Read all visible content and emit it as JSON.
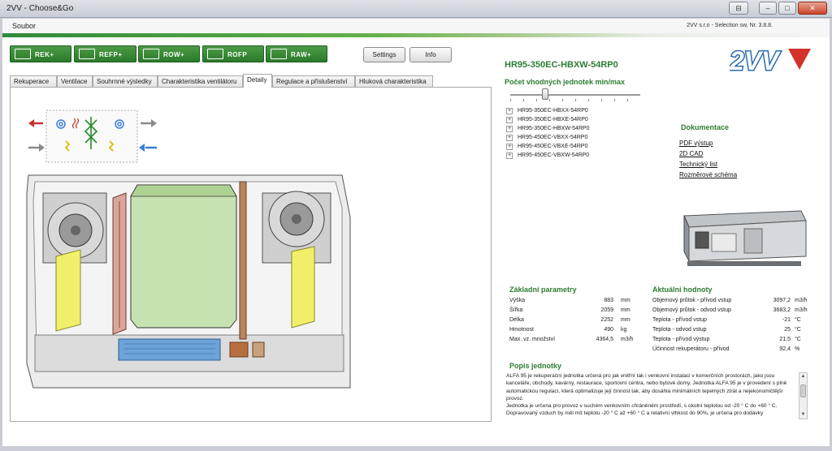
{
  "window": {
    "title": "2VV - Choose&Go",
    "menu_file": "Soubor",
    "version": "2VV s.r.o - Selection sw, Nr. 3.8.8."
  },
  "toolbar": {
    "buttons": [
      {
        "label": "REK+",
        "icon": "recuperator-icon"
      },
      {
        "label": "REFP+",
        "icon": "heat-exchanger-icon"
      },
      {
        "label": "ROW+",
        "icon": "row-unit-icon"
      },
      {
        "label": "ROFP",
        "icon": "rofp-unit-icon"
      },
      {
        "label": "RAW+",
        "icon": "raw-unit-icon"
      }
    ],
    "settings": "Settings",
    "info": "Info"
  },
  "tabs": [
    {
      "label": "Rekuperace"
    },
    {
      "label": "Ventilace"
    },
    {
      "label": "Souhrnné výsledky"
    },
    {
      "label": "Charakteristika ventilátoru"
    },
    {
      "label": "Detaily",
      "active": true
    },
    {
      "label": "Regulace a příslušenství"
    },
    {
      "label": "Hluková charakteristika"
    }
  ],
  "model": "HR95-350EC-HBXW-54RP0",
  "unit_count_title": "Počet vhodných jednotek min/max",
  "variants": [
    "HR95-350EC-HBXX-54RP0",
    "HR95-350EC-HBXE-54RP0",
    "HR95-350EC-HBXW-54RP0",
    "HR95-450EC-VBXX-54RP0",
    "HR95-450EC-VBXE-54RP0",
    "HR95-450EC-VBXW-54RP0"
  ],
  "documentation": {
    "title": "Dokumentace",
    "links": [
      "PDF výstup",
      "2D CAD",
      "Technický list",
      "Rozměrové schéma"
    ]
  },
  "basic_params": {
    "title": "Základní parametry",
    "rows": [
      {
        "name": "Výška",
        "value": "883",
        "unit": "mm"
      },
      {
        "name": "Šířka",
        "value": "2059",
        "unit": "mm"
      },
      {
        "name": "Délka",
        "value": "2252",
        "unit": "mm"
      },
      {
        "name": "Hmotnost",
        "value": "490",
        "unit": "kg"
      },
      {
        "name": "Max. vz. množství",
        "value": "4364,5",
        "unit": "m3/h"
      }
    ]
  },
  "current_values": {
    "title": "Aktuální hodnoty",
    "rows": [
      {
        "name": "Objemový průtok - přívod vstup",
        "value": "3097,2",
        "unit": "m3/h"
      },
      {
        "name": "Objemový průtok - odvod vstup",
        "value": "3683,2",
        "unit": "m3/h"
      },
      {
        "name": "Teplota - přívod vstup",
        "value": "-21",
        "unit": "°C"
      },
      {
        "name": "Teplota - odvod vstup",
        "value": "25",
        "unit": "°C"
      },
      {
        "name": "Teplota - přívod výstup",
        "value": "21,5",
        "unit": "°C"
      },
      {
        "name": "Účinnost rekuperátoru - přívod",
        "value": "92,4",
        "unit": "%"
      }
    ]
  },
  "description": {
    "title": "Popis jednotky",
    "lines": [
      "ALFA 95 je rekuperační jednotka určená pro jak vnitřní tak i venkovní instalaci v komerčních prostorách, jako jsou kanceláře, obchody, kavárny, restaurace, sportovní centra, nebo bytové domy. Jednotka ALFA 95 je v provedení s plně automatickou regulací, která optimalizuje její činnost tak, aby dosáhla minimálních tepelných ztrát a nejekonomičtější provoz.",
      "Jednotka je určena pro provoz v suchém venkovním chráněném prostředí, s okolní teplotou od -20 ° C do +60 ° C. Dopravovaný vzduch by měl mít teplotu -20 ° C až +60 ° C a relativní vlhkost do 90%, je určena pro dodávky"
    ]
  },
  "colors": {
    "accent_green": "#2d7d32",
    "toolbar_green": "#3a8c3a",
    "logo_blue": "#2b6cb0",
    "logo_red": "#d3322b",
    "supply_arrow": "#3b7dd8",
    "exhaust_arrow": "#c8302b",
    "heat_exchanger": "#c6e2b0",
    "filter_yellow": "#f2ef6a"
  },
  "logo_text": "2VV"
}
